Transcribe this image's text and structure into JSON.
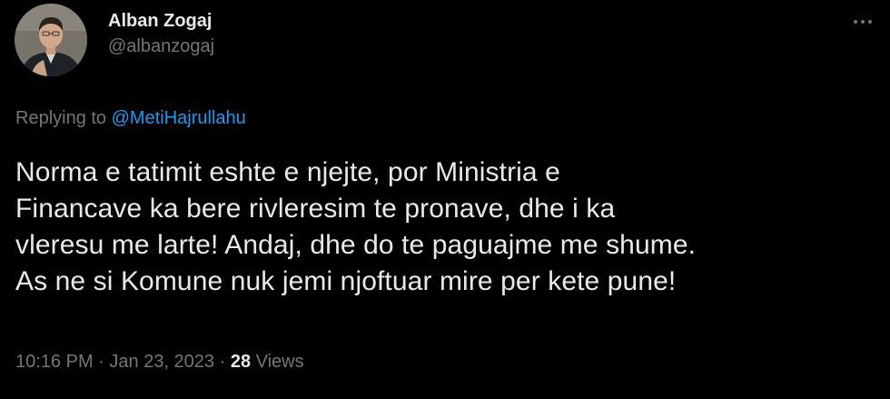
{
  "author": {
    "display_name": "Alban Zogaj",
    "handle": "@albanzogaj"
  },
  "reply": {
    "prefix": "Replying to ",
    "mention": "@MetiHajrullahu"
  },
  "tweet": {
    "lines": [
      "Norma e tatimit eshte e njejte, por Ministria e",
      "Financave ka bere rivleresim te pronave, dhe i ka",
      "vleresu me larte! Andaj, dhe do te paguajme me shume.",
      "As ne si Komune nuk jemi njoftuar mire per kete pune!"
    ]
  },
  "meta": {
    "time": "10:16 PM",
    "separator": " · ",
    "date": "Jan 23, 2023",
    "views_count": "28",
    "views_label": " Views"
  },
  "icons": {
    "more": "more-horizontal-icon",
    "avatar": "profile-photo"
  },
  "colors": {
    "background": "#000000",
    "text_primary": "#e7e9ea",
    "text_secondary": "#71767b",
    "accent": "#1d9bf0"
  }
}
